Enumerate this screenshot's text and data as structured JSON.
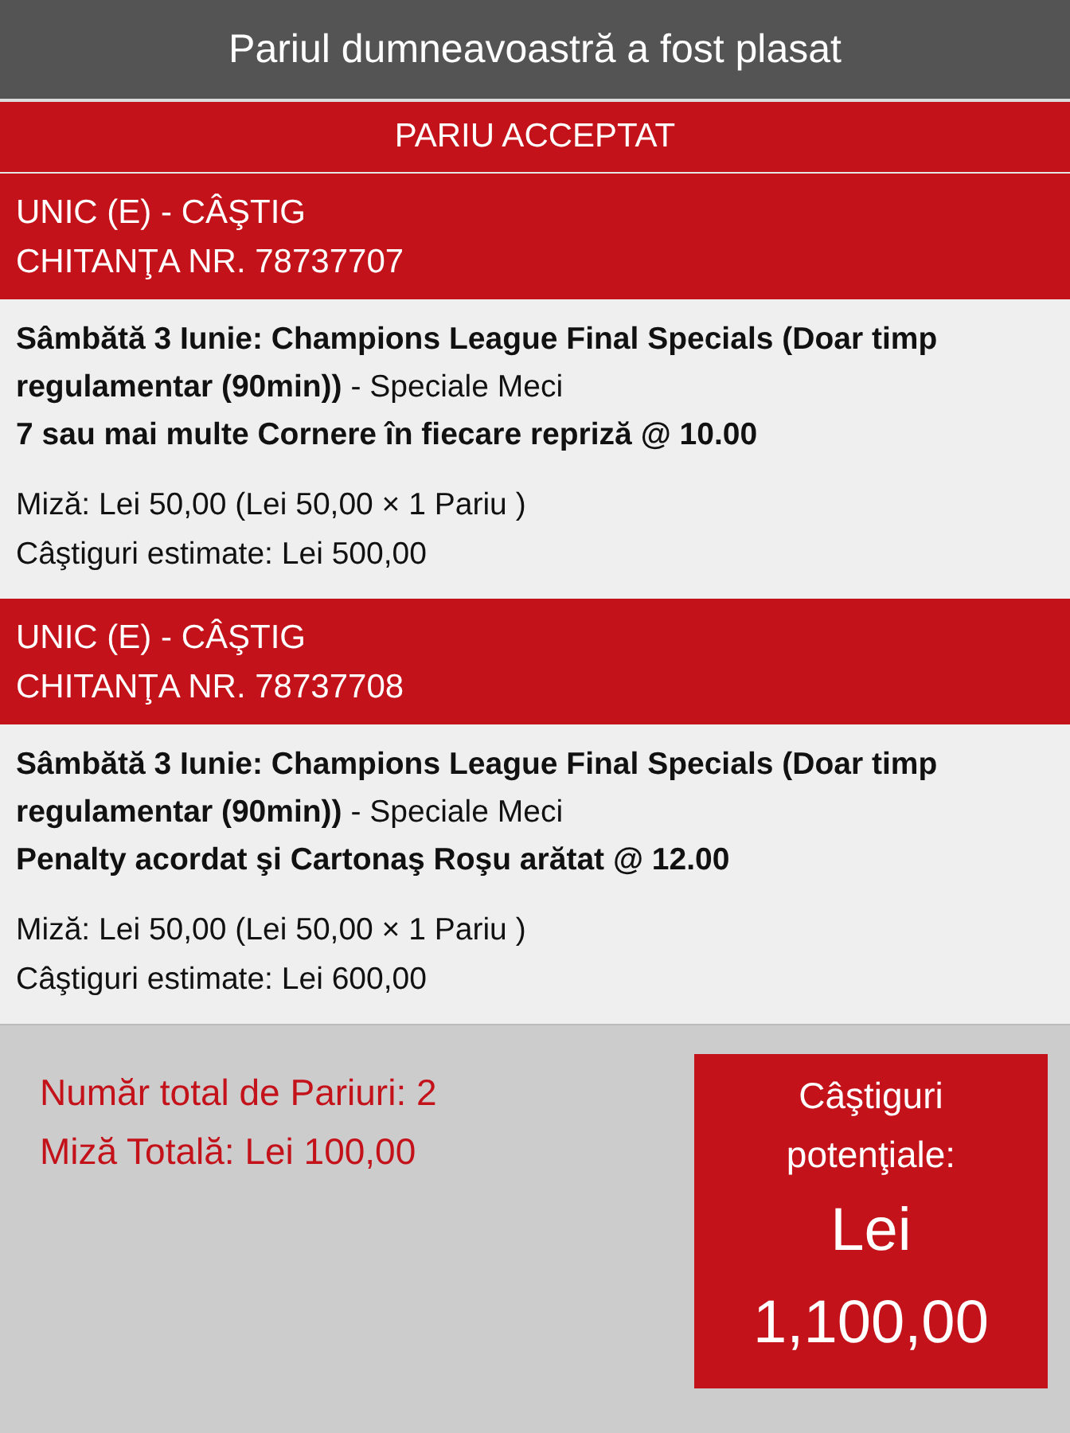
{
  "header": {
    "title": "Pariul dumneavoastră a fost plasat"
  },
  "status_banner": "PARIU ACCEPTAT",
  "bets": [
    {
      "type": "UNIC (E) - CÂŞTIG",
      "receipt": "CHITANŢA NR. 78737707",
      "event": "**Sâmbătă 3 Iunie: Champions League Final Specials (Doar timp regulamentar (90min))** - Speciale Meci",
      "selection": "7 sau mai multe Cornere în fiecare repriză @ 10.00",
      "stake": "Miză: Lei 50,00 (Lei 50,00 × 1 Pariu )",
      "winnings": "Câştiguri estimate: Lei 500,00"
    },
    {
      "type": "UNIC (E) - CÂŞTIG",
      "receipt": "CHITANŢA NR. 78737708",
      "event": "**Sâmbătă 3 Iunie: Champions League Final Specials (Doar timp regulamentar (90min))** - Speciale Meci",
      "selection": "Penalty acordat şi Cartonaş Roşu arătat @ 12.00",
      "stake": "Miză: Lei 50,00 (Lei 50,00 × 1 Pariu )",
      "winnings": "Câştiguri estimate: Lei 600,00"
    }
  ],
  "summary": {
    "total_bets": "Număr total de Pariuri: 2",
    "total_stake": "Miză Totală: Lei 100,00",
    "potential_label": "Câştiguri potenţiale:",
    "potential_currency": "Lei",
    "potential_amount": "1,100,00"
  }
}
